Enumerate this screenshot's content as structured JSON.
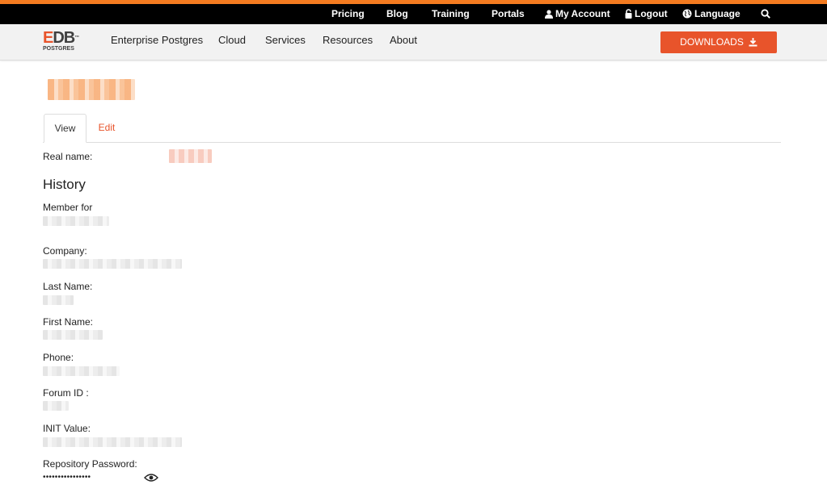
{
  "colors": {
    "accent": "#f47b20",
    "brand": "#e8542b",
    "topbar": "#000000",
    "navbar": "#f2f2f2"
  },
  "topnav": {
    "pricing": "Pricing",
    "blog": "Blog",
    "training": "Training",
    "portals": "Portals",
    "my_account": "My Account",
    "logout": "Logout",
    "language": "Language"
  },
  "brand": {
    "logo_main_e": "E",
    "logo_main_db": "DB",
    "logo_tm": "™",
    "logo_sub": "POSTGRES"
  },
  "mainnav": {
    "enterprise_postgres": "Enterprise Postgres",
    "cloud": "Cloud",
    "services": "Services",
    "resources": "Resources",
    "about": "About",
    "downloads": "DOWNLOADS"
  },
  "profile": {
    "tabs": {
      "view": "View",
      "edit": "Edit"
    },
    "real_name_label": "Real name:",
    "history_title": "History",
    "fields": {
      "member_for": "Member for",
      "company": "Company:",
      "last_name": "Last Name:",
      "first_name": "First Name:",
      "phone": "Phone:",
      "forum_id": "Forum ID :",
      "init_value": "INIT Value:",
      "repository_password": "Repository Password:"
    },
    "password_mask": "••••••••••••••••"
  },
  "icons": [
    "user-icon",
    "lock-icon",
    "globe-icon",
    "search-icon",
    "download-icon",
    "eye-icon"
  ]
}
